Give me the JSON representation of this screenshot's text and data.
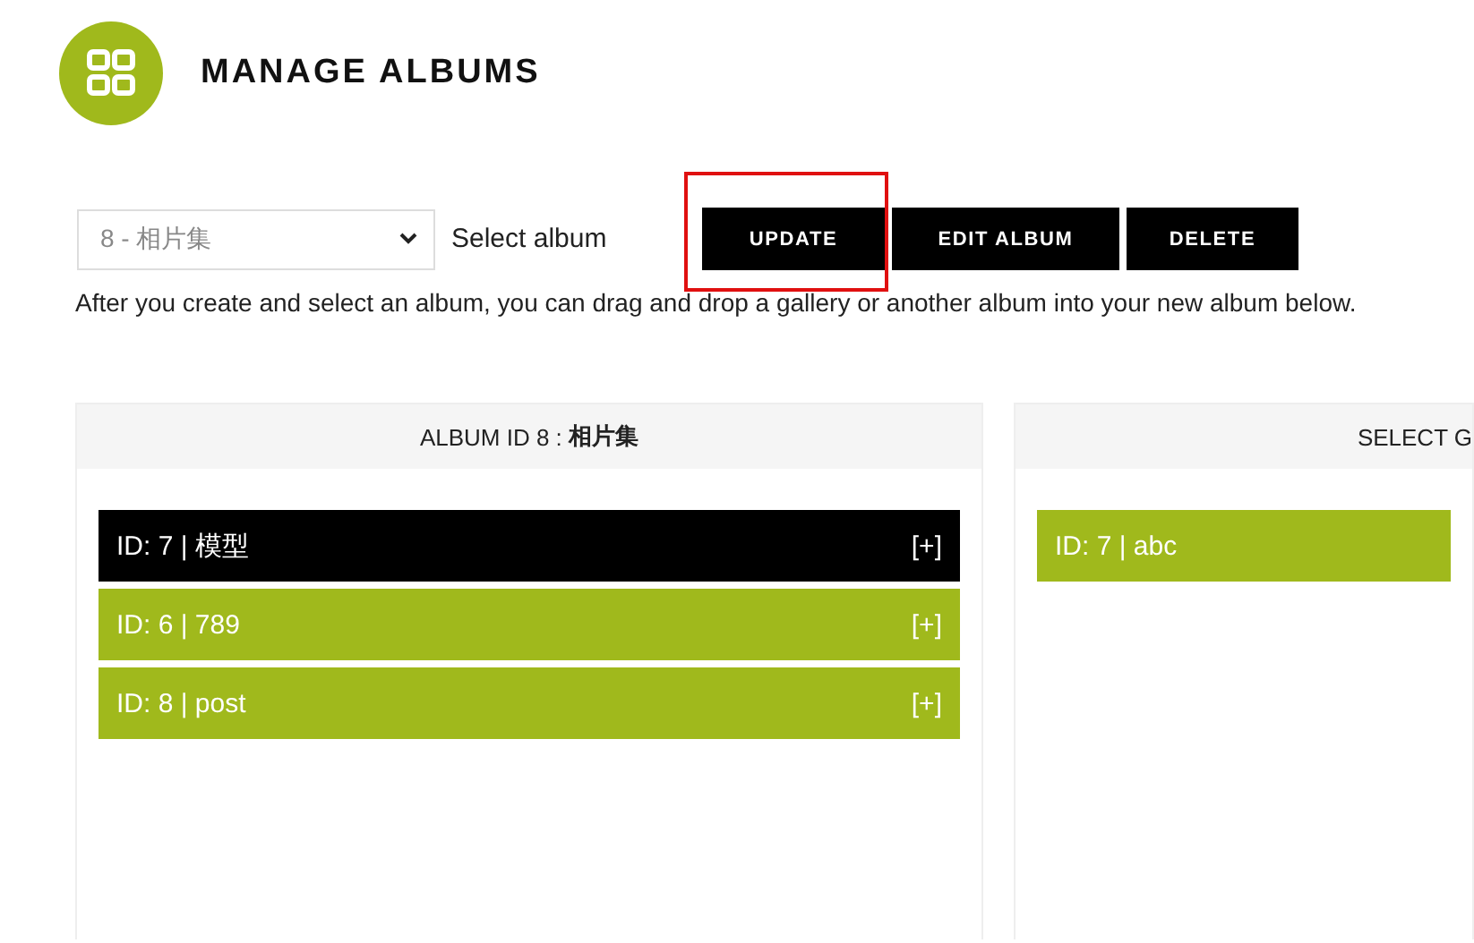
{
  "header": {
    "title": "MANAGE ALBUMS"
  },
  "toolbar": {
    "select": {
      "value": "8 - 相片集"
    },
    "select_label": "Select album",
    "buttons": [
      {
        "label": "UPDATE",
        "highlighted": true
      },
      {
        "label": "EDIT ALBUM",
        "highlighted": false
      },
      {
        "label": "DELETE",
        "highlighted": false
      }
    ]
  },
  "instructions": "After you create and select an album, you can drag and drop a gallery or another album into your new album below.",
  "panels": [
    {
      "title": "ALBUM ID 8 : **相片集**",
      "items": [
        {
          "label": "ID: 7 | 模型",
          "action": "[+]",
          "selected": true
        },
        {
          "label": "ID: 6 | 789",
          "action": "[+]",
          "selected": false
        },
        {
          "label": "ID: 8 | post",
          "action": "[+]",
          "selected": false
        }
      ]
    },
    {
      "title": "SELECT G",
      "items": [
        {
          "label": "ID: 7 | abc",
          "selected": false
        }
      ]
    }
  ]
}
